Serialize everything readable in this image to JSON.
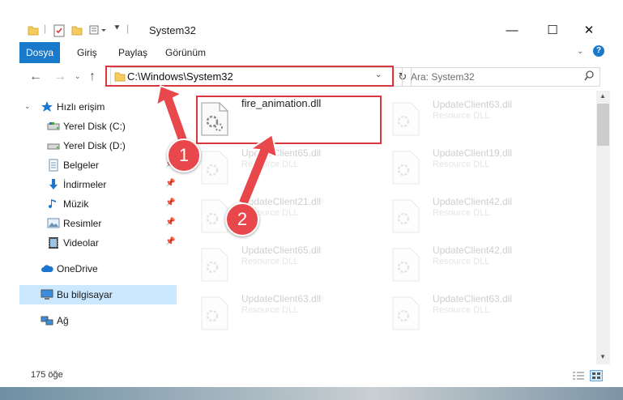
{
  "window": {
    "title": "System32"
  },
  "controls": {
    "minimize": "—",
    "maximize": "☐",
    "close": "✕"
  },
  "ribbon": {
    "tabs": [
      "Dosya",
      "Giriş",
      "Paylaş",
      "Görünüm"
    ],
    "help": "?"
  },
  "address": {
    "path": "C:\\Windows\\System32",
    "search_placeholder": "Ara: System32"
  },
  "sidebar": {
    "items": [
      {
        "label": "Hızlı erişim",
        "icon": "star-icon"
      },
      {
        "label": "Yerel Disk (C:)",
        "icon": "drive-icon",
        "pinned": true
      },
      {
        "label": "Yerel Disk (D:)",
        "icon": "drive-icon",
        "pinned": true
      },
      {
        "label": "Belgeler",
        "icon": "documents-icon",
        "pinned": true
      },
      {
        "label": "İndirmeler",
        "icon": "download-icon",
        "pinned": true
      },
      {
        "label": "Müzik",
        "icon": "music-icon",
        "pinned": true
      },
      {
        "label": "Resimler",
        "icon": "pictures-icon",
        "pinned": true
      },
      {
        "label": "Videolar",
        "icon": "video-icon",
        "pinned": true
      },
      {
        "label": "OneDrive",
        "icon": "cloud-icon"
      },
      {
        "label": "Bu bilgisayar",
        "icon": "computer-icon",
        "selected": true
      },
      {
        "label": "Ağ",
        "icon": "network-icon"
      }
    ]
  },
  "files": [
    {
      "name": "fire_animation.dll",
      "type": ""
    },
    {
      "name": "UpdateClient63.dll",
      "type": "Resource DLL"
    },
    {
      "name": "UpdateClient65.dll",
      "type": "Resource DLL"
    },
    {
      "name": "UpdateClient19.dll",
      "type": "Resource DLL"
    },
    {
      "name": "UpdateClient21.dll",
      "type": "Resource DLL"
    },
    {
      "name": "UpdateClient42.dll",
      "type": "Resource DLL"
    },
    {
      "name": "UpdateClient65.dll",
      "type": "Resource DLL"
    },
    {
      "name": "UpdateClient42.dll",
      "type": "Resource DLL"
    },
    {
      "name": "UpdateClient63.dll",
      "type": "Resource DLL"
    },
    {
      "name": "UpdateClient63.dll",
      "type": "Resource DLL"
    }
  ],
  "status": {
    "count": "175 öğe"
  },
  "annotations": {
    "step1": "1",
    "step2": "2",
    "color": "#e8474b"
  }
}
